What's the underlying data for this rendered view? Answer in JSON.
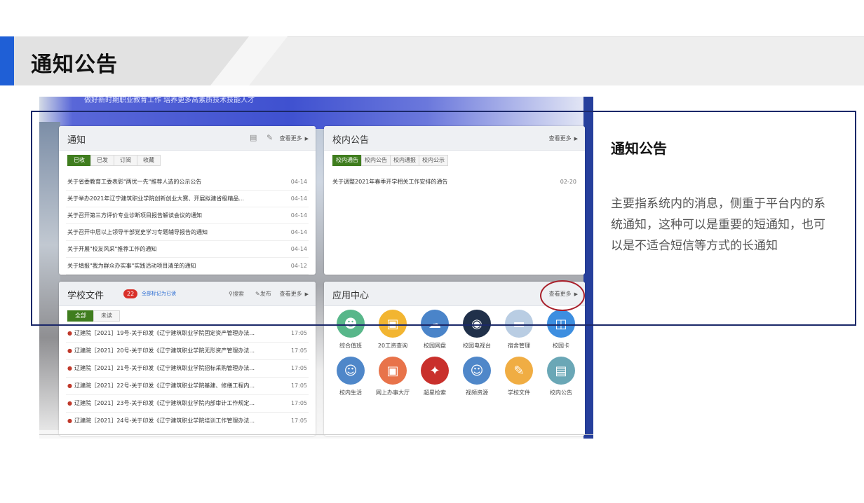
{
  "slide": {
    "title": "通知公告",
    "description_title": "通知公告",
    "description_body": "主要指系统内的消息，侧重于平台内的系统通知，这种可以是重要的短通知，也可以是不适合短信等方式的长通知"
  },
  "portal": {
    "banner_text": "做好新时期职业教育工作 培养更多高素质技术技能人才",
    "notice": {
      "title": "通知",
      "more": "查看更多",
      "tabs": [
        "已收",
        "已发",
        "订阅",
        "收藏"
      ],
      "items": [
        {
          "title": "关于省委教育工委表彰\"两优一先\"推荐人选的公示公告",
          "date": "04-14"
        },
        {
          "title": "关于举办2021年辽宁建筑职业学院创新创业大赛、开展拟建省级精品...",
          "date": "04-14"
        },
        {
          "title": "关于召开第三方评价专业诊断项目报告解读会议的通知",
          "date": "04-14"
        },
        {
          "title": "关于召开中层以上领导干部党史学习专题辅导报告的通知",
          "date": "04-14"
        },
        {
          "title": "关于开展\"校友风采\"推荐工作的通知",
          "date": "04-14"
        },
        {
          "title": "关于填报\"我为群众办实事\"实践活动项目清单的通知",
          "date": "04-12"
        }
      ]
    },
    "campus_notice": {
      "title": "校内公告",
      "more": "查看更多",
      "tabs": [
        "校内通告",
        "校内公告",
        "校内通报",
        "校内公示"
      ],
      "items": [
        {
          "title": "关于调整2021年春季开学相关工作安排的通告",
          "date": "02-20"
        }
      ]
    },
    "school_files": {
      "title": "学校文件",
      "badge": "22",
      "mark_all_read": "全部标记为已读",
      "search": "搜索",
      "publish": "发布",
      "more": "查看更多",
      "tabs": [
        "全部",
        "未读"
      ],
      "items": [
        {
          "title": "辽建院［2021］19号-关于印发《辽宁建筑职业学院固定资产管理办法...",
          "time": "17:05"
        },
        {
          "title": "辽建院［2021］20号-关于印发《辽宁建筑职业学院无形资产管理办法...",
          "time": "17:05"
        },
        {
          "title": "辽建院［2021］21号-关于印发《辽宁建筑职业学院招标采购管理办法...",
          "time": "17:05"
        },
        {
          "title": "辽建院［2021］22号-关于印发《辽宁建筑职业学院基建、修缮工程内...",
          "time": "17:05"
        },
        {
          "title": "辽建院［2021］23号-关于印发《辽宁建筑职业学院内部审计工作规定...",
          "time": "17:05"
        },
        {
          "title": "辽建院［2021］24号-关于印发《辽宁建筑职业学院培训工作管理办法...",
          "time": "17:05"
        }
      ]
    },
    "app_center": {
      "title": "应用中心",
      "more": "查看更多",
      "apps": [
        {
          "label": "综合值班",
          "icon": "duty-icon",
          "color": "#58b78a"
        },
        {
          "label": "20工资查询",
          "icon": "salary-card-icon",
          "color": "#f2b531"
        },
        {
          "label": "校园网盘",
          "icon": "cloud-drive-icon",
          "color": "#4a84c9"
        },
        {
          "label": "校园电视台",
          "icon": "tv-station-icon",
          "color": "#20304a"
        },
        {
          "label": "宿舍管理",
          "icon": "dormitory-icon",
          "color": "#b9cde3"
        },
        {
          "label": "校园卡",
          "icon": "campus-card-icon",
          "color": "#3d8ee0"
        },
        {
          "label": "校内生活",
          "icon": "campus-life-icon",
          "color": "#4f87c9"
        },
        {
          "label": "网上办事大厅",
          "icon": "online-hall-icon",
          "color": "#e8734a"
        },
        {
          "label": "超星检索",
          "icon": "search-engine-icon",
          "color": "#c9302c"
        },
        {
          "label": "视频资源",
          "icon": "video-resource-icon",
          "color": "#4f87c9"
        },
        {
          "label": "学校文件",
          "icon": "school-file-icon",
          "color": "#f0ad43"
        },
        {
          "label": "校内公告",
          "icon": "campus-notice-icon",
          "color": "#6aa7b6"
        }
      ]
    }
  }
}
